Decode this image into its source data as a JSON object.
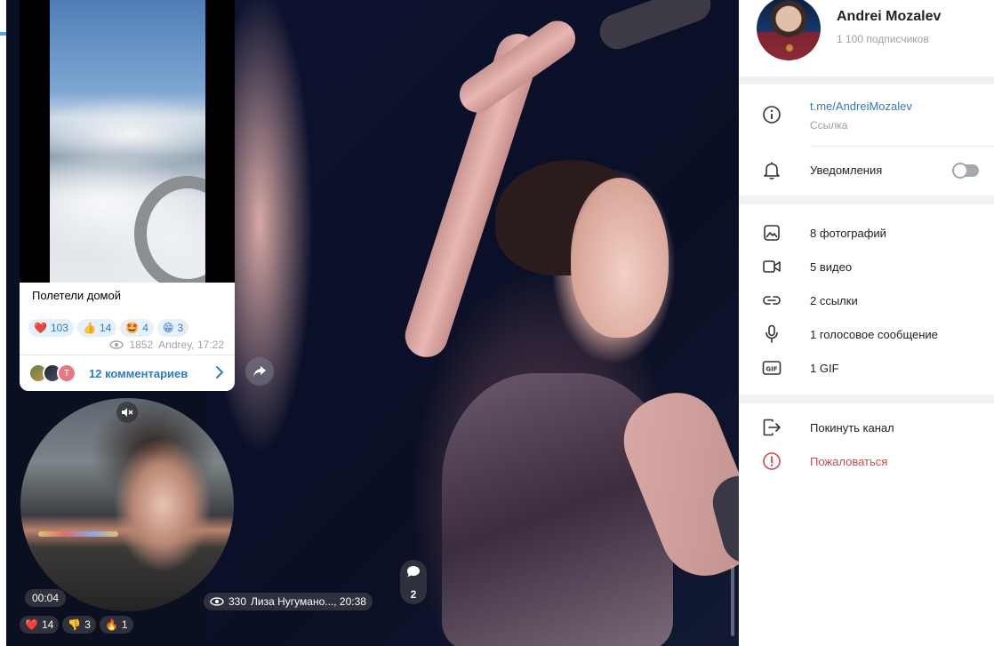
{
  "post_video": {
    "caption": "Полетели домой",
    "reactions": [
      {
        "emoji": "❤️",
        "count": "103"
      },
      {
        "emoji": "👍",
        "count": "14"
      },
      {
        "emoji": "🤩",
        "count": "4"
      },
      {
        "emoji": "😁",
        "count": "3"
      }
    ],
    "views": "1852",
    "author_time": "Andrey, 17:22",
    "comments_label": "12 комментариев",
    "commenter_initial": "T"
  },
  "round_video": {
    "duration": "00:04",
    "reactions": [
      {
        "emoji": "❤️",
        "count": "14"
      },
      {
        "emoji": "👎",
        "count": "3"
      },
      {
        "emoji": "🔥",
        "count": "1"
      }
    ]
  },
  "photo_post": {
    "views": "330",
    "author_time": "Лиза Нугумано..., 20:38",
    "comments_count": "2"
  },
  "channel": {
    "name": "Andrei Mozalev",
    "subscribers": "1 100 подписчиков",
    "link": "t.me/AndreiMozalev",
    "link_caption": "Ссылка",
    "notifications_label": "Уведомления",
    "notifications_enabled": false
  },
  "media_counts": {
    "photos": "8 фотографий",
    "videos": "5 видео",
    "links": "2 ссылки",
    "voice": "1 голосовое сообщение",
    "gif": "1 GIF"
  },
  "actions": {
    "leave": "Покинуть канал",
    "report": "Пожаловаться"
  },
  "colors": {
    "accent": "#2e7bc3",
    "danger": "#d14a4a",
    "panel_bg": "#f0f2f4"
  }
}
